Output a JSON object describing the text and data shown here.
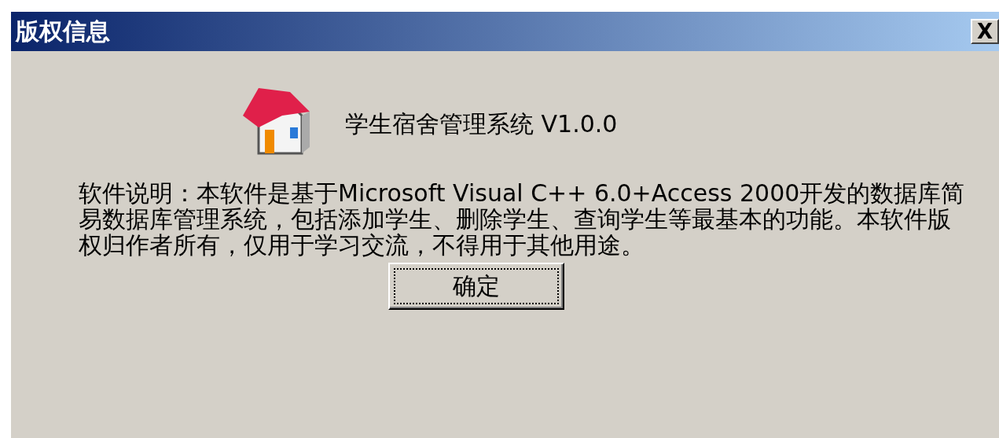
{
  "window": {
    "title": "版权信息",
    "close": "X"
  },
  "product": {
    "name": "学生宿舍管理系统 V1.0.0"
  },
  "description": "软件说明：本软件是基于Microsoft Visual C++ 6.0+Access 2000开发的数据库简易数据库管理系统，包括添加学生、删除学生、查询学生等最基本的功能。本软件版权归作者所有，仅用于学习交流，不得用于其他用途。",
  "buttons": [
    {
      "label": "确定",
      "focused": true
    }
  ]
}
